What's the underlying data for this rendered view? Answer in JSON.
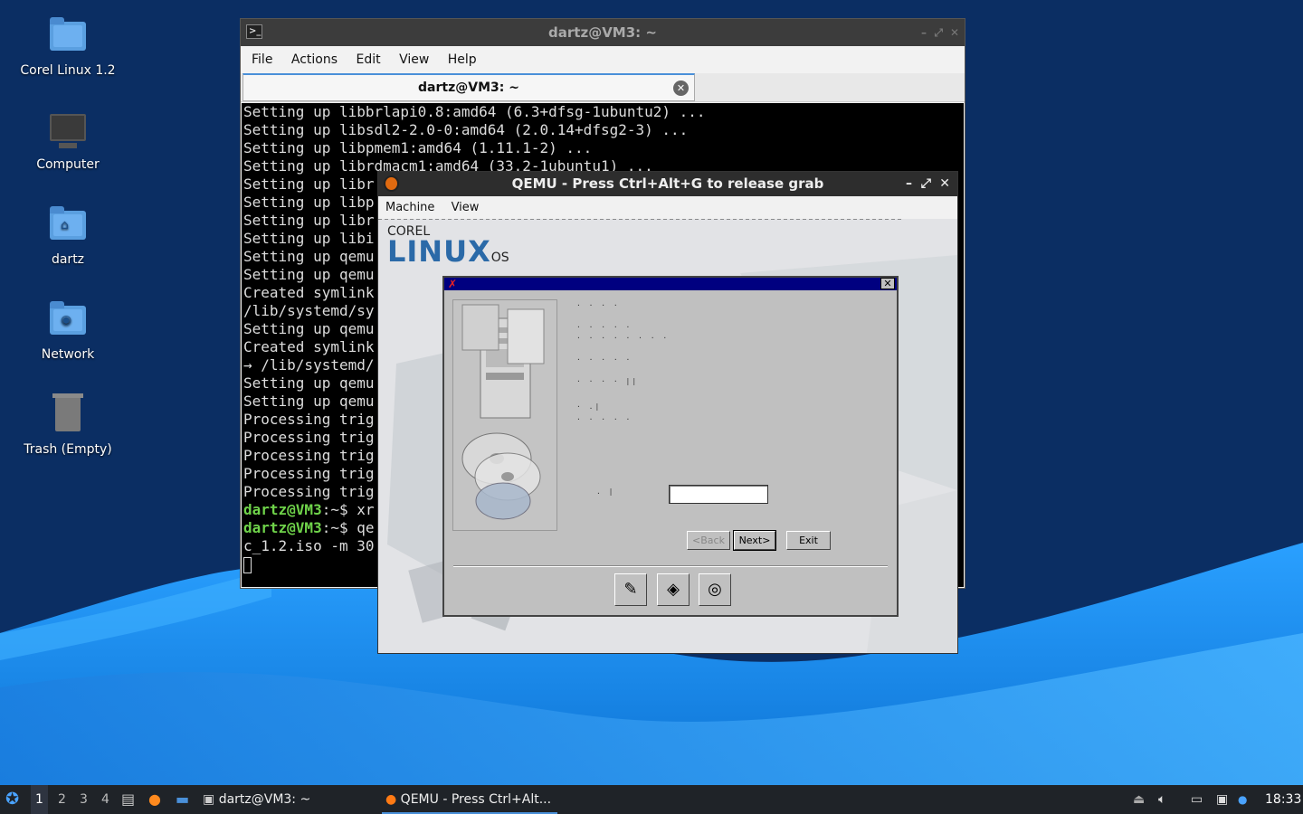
{
  "desktop": {
    "icons": [
      {
        "label": "Corel Linux 1.2",
        "icon": "folder-icon"
      },
      {
        "label": "Computer",
        "icon": "computer-icon"
      },
      {
        "label": "dartz",
        "icon": "home-folder-icon"
      },
      {
        "label": "Network",
        "icon": "network-folder-icon"
      },
      {
        "label": "Trash (Empty)",
        "icon": "trash-icon"
      }
    ]
  },
  "terminal": {
    "title": "dartz@VM3: ~",
    "menu": [
      "File",
      "Actions",
      "Edit",
      "View",
      "Help"
    ],
    "tab_label": "dartz@VM3: ~",
    "lines": [
      "Setting up libbrlapi0.8:amd64 (6.3+dfsg-1ubuntu2) ...",
      "Setting up libsdl2-2.0-0:amd64 (2.0.14+dfsg2-3) ...",
      "Setting up libpmem1:amd64 (1.11.1-2) ...",
      "Setting up librdmacm1:amd64 (33.2-1ubuntu1) ...",
      "Setting up libr",
      "Setting up libp",
      "Setting up libr",
      "Setting up libi",
      "Setting up qemu",
      "Setting up qemu",
      "Created symlink",
      "/lib/systemd/sy",
      "Setting up qemu",
      "Created symlink",
      "→ /lib/systemd/",
      "Setting up qemu",
      "Setting up qemu",
      "Processing trig",
      "Processing trig",
      "Processing trig",
      "Processing trig",
      "Processing trig"
    ],
    "prompt_user": "dartz@VM3",
    "prompt_path": ":~",
    "cmd1": "$ xr",
    "cmd2": "$ qe",
    "continuation": "c_1.2.iso -m 30"
  },
  "qemu": {
    "title": "QEMU - Press Ctrl+Alt+G to release grab",
    "menu": [
      "Machine",
      "View"
    ],
    "logo": {
      "corel": "COREL",
      "linux": "LINUX",
      "os": "OS"
    },
    "installer": {
      "back_label": "<Back",
      "next_label": "Next>",
      "exit_label": "Exit",
      "field_value": ""
    }
  },
  "taskbar": {
    "workspaces": [
      "1",
      "2",
      "3",
      "4"
    ],
    "active_workspace": "1",
    "tasks": [
      {
        "label": "dartz@VM3: ~",
        "icon": "terminal-icon"
      },
      {
        "label": "QEMU - Press Ctrl+Alt...",
        "icon": "qemu-icon"
      }
    ],
    "clock": "18:33"
  },
  "colors": {
    "accent": "#4a90d9",
    "prompt": "#6fd34a",
    "wallpaper_dark": "#0b2e63",
    "wallpaper_wave": "#1e8ef0"
  }
}
